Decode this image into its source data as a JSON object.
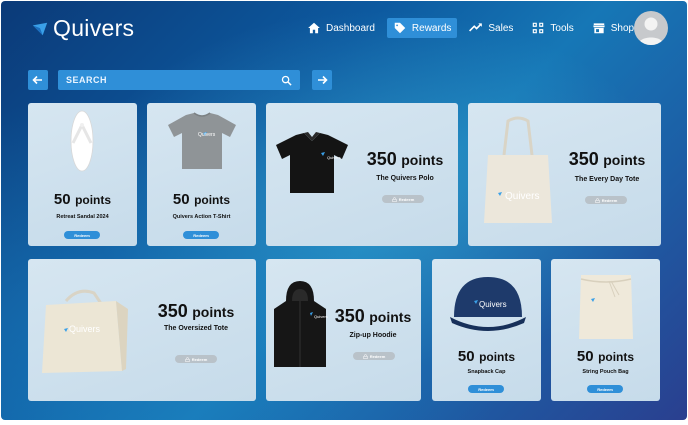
{
  "app": {
    "name": "Quivers"
  },
  "nav": [
    {
      "label": "Dashboard",
      "icon": "home-icon",
      "active": false
    },
    {
      "label": "Rewards",
      "icon": "tag-icon",
      "active": true
    },
    {
      "label": "Sales",
      "icon": "trend-icon",
      "active": false
    },
    {
      "label": "Tools",
      "icon": "grid-icon",
      "active": false
    },
    {
      "label": "Shop",
      "icon": "store-icon",
      "active": false
    }
  ],
  "search": {
    "placeholder": "SEARCH"
  },
  "redeem_label": "Redeem",
  "products": [
    {
      "points": "50",
      "unit": "points",
      "name": "Retreat Sandal 2024",
      "status": "available"
    },
    {
      "points": "50",
      "unit": "points",
      "name": "Quivers Action T-Shirt",
      "status": "available"
    },
    {
      "points": "350",
      "unit": "points",
      "name": "The Quivers Polo",
      "status": "locked"
    },
    {
      "points": "350",
      "unit": "points",
      "name": "The Every Day Tote",
      "status": "locked"
    },
    {
      "points": "350",
      "unit": "points",
      "name": "The Oversized Tote",
      "status": "locked"
    },
    {
      "points": "350",
      "unit": "points",
      "name": "Zip-up Hoodie",
      "status": "locked"
    },
    {
      "points": "50",
      "unit": "points",
      "name": "Snapback Cap",
      "status": "available"
    },
    {
      "points": "50",
      "unit": "points",
      "name": "String Pouch Bag",
      "status": "available"
    }
  ],
  "brand_mark": "Quivers",
  "colors": {
    "accent": "#2f8fd8",
    "locked": "#b9c2c9"
  }
}
